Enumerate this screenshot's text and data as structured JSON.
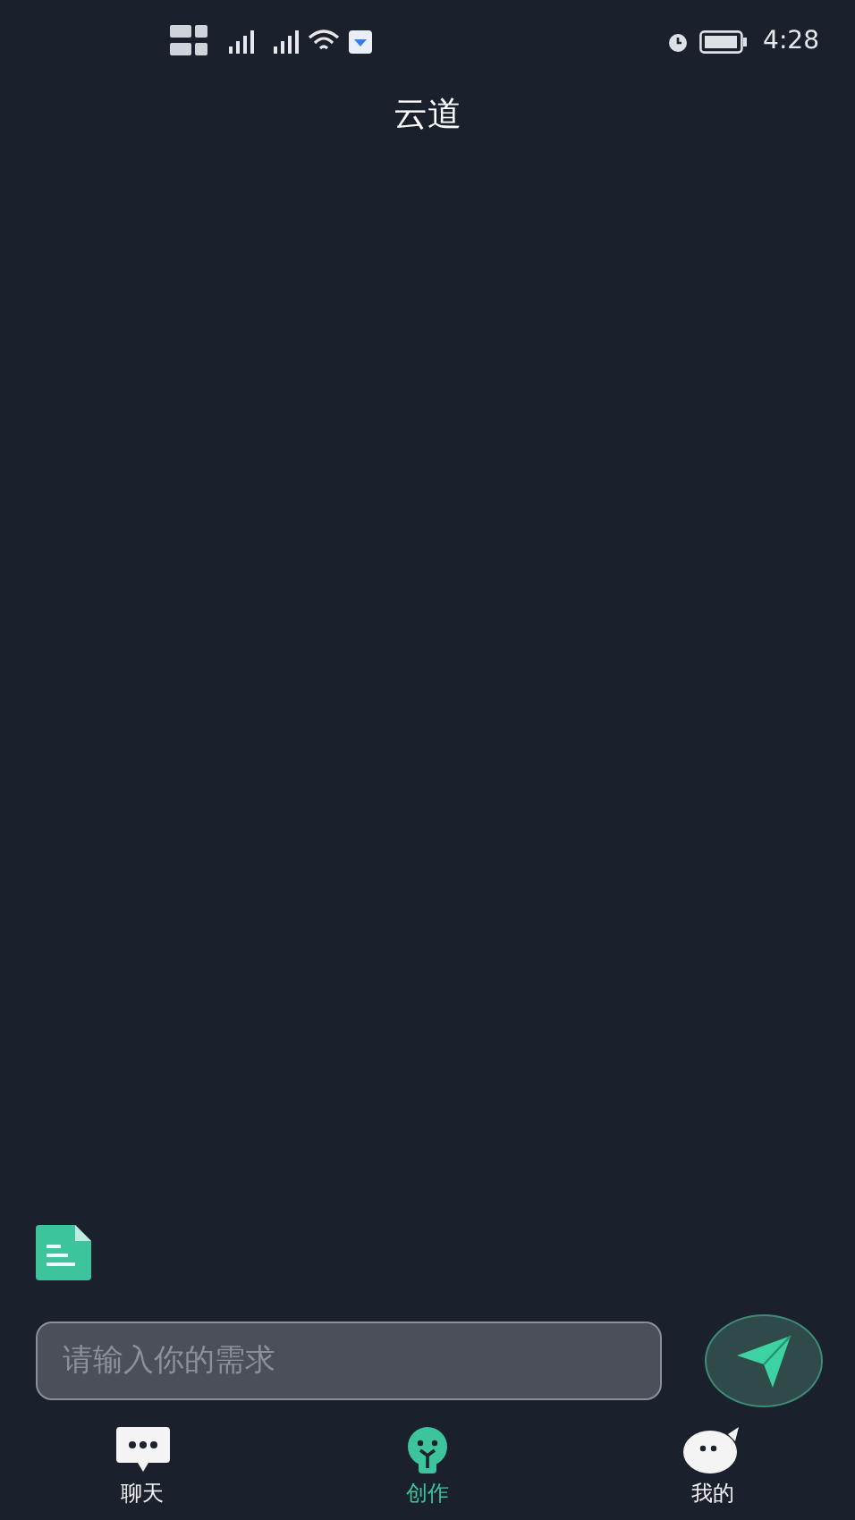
{
  "status_bar": {
    "time": "4:28"
  },
  "header": {
    "title": "云道"
  },
  "composer": {
    "placeholder": "请输入你的需求"
  },
  "nav": [
    {
      "label": "聊天",
      "kind": "chat",
      "selected": false
    },
    {
      "label": "创作",
      "kind": "create",
      "selected": true
    },
    {
      "label": "我的",
      "kind": "me",
      "selected": false
    }
  ]
}
